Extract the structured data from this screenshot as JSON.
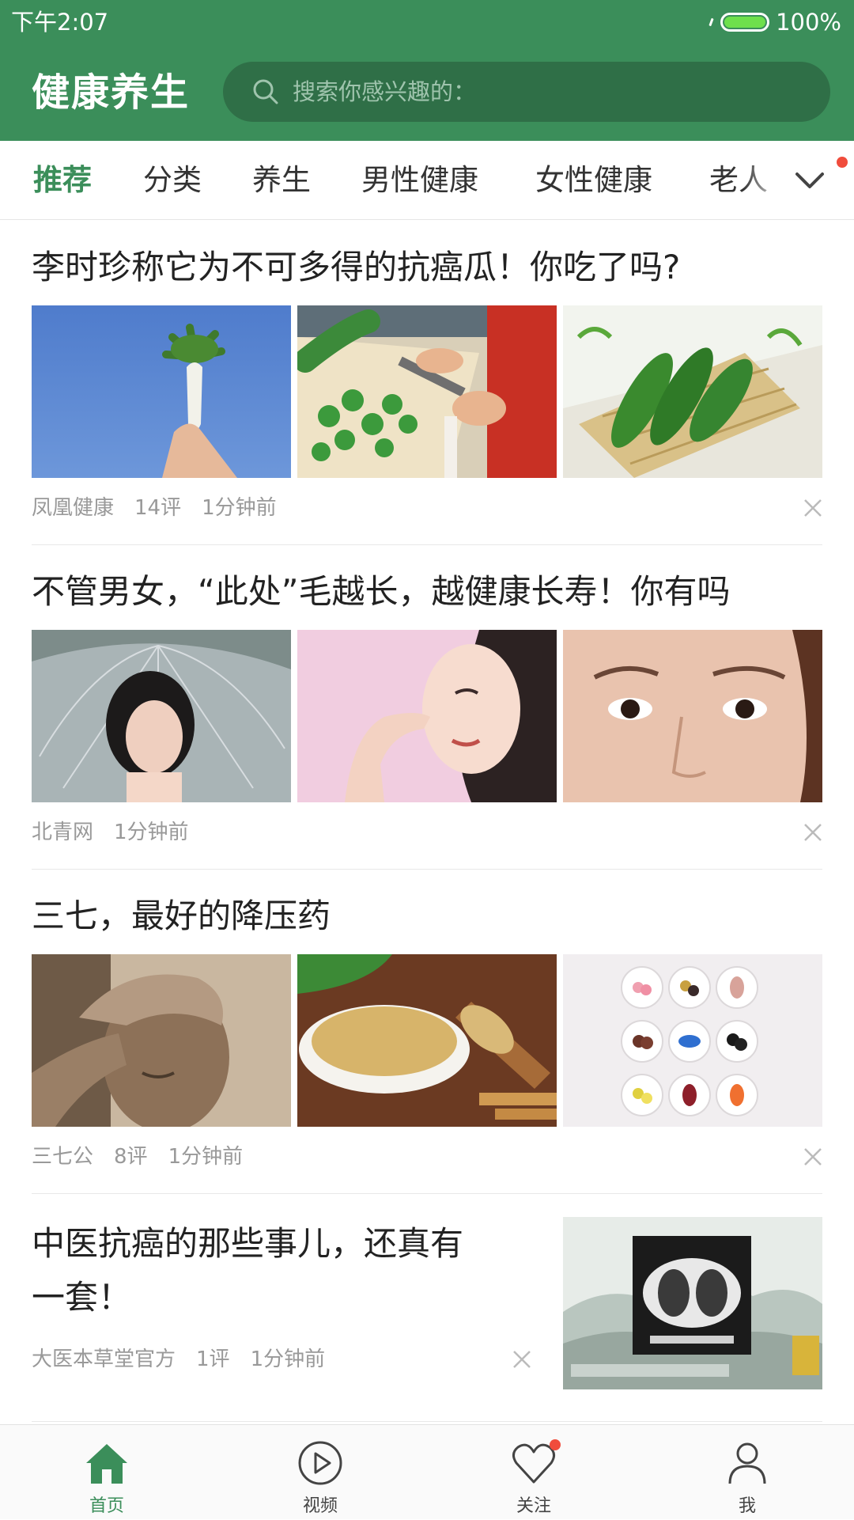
{
  "status_bar": {
    "time": "下午2:07",
    "battery": "100%"
  },
  "header": {
    "title": "健康养生",
    "search_placeholder": "搜索你感兴趣的："
  },
  "tabs": [
    {
      "label": "推荐",
      "active": true
    },
    {
      "label": "分类"
    },
    {
      "label": "养生"
    },
    {
      "label": "男性健康"
    },
    {
      "label": "女性健康"
    },
    {
      "label": "老人"
    }
  ],
  "articles": [
    {
      "title": "李时珍称它为不可多得的抗癌瓜！你吃了吗?",
      "source": "凤凰健康",
      "comments": "14评",
      "time": "1分钟前",
      "images": [
        "radish-in-hand",
        "cutting-bitter-melon",
        "bitter-melons-in-basket"
      ]
    },
    {
      "title": "不管男女，“此处”毛越长，越健康长寿！你有吗",
      "source": "北青网",
      "time": "1分钟前",
      "images": [
        "woman-with-umbrella",
        "woman-touching-nose",
        "woman-eyes-closeup"
      ]
    },
    {
      "title": "三七，最好的降压药",
      "source": "三七公",
      "comments": "8评",
      "time": "1分钟前",
      "images": [
        "man-holding-head",
        "herbal-powder-bowl",
        "pills-in-cups"
      ]
    },
    {
      "title_line1": "中医抗癌的那些事儿，还真有",
      "title_line2": "一套！",
      "source": "大医本草堂官方",
      "comments": "1评",
      "time": "1分钟前",
      "images": [
        "lung-ct-scan-video"
      ]
    }
  ],
  "bottom_nav": [
    {
      "label": "首页",
      "icon": "home-icon",
      "active": true
    },
    {
      "label": "视频",
      "icon": "play-icon"
    },
    {
      "label": "关注",
      "icon": "heart-icon",
      "badge": true
    },
    {
      "label": "我",
      "icon": "person-icon"
    }
  ],
  "colors": {
    "primary": "#3b8e5a",
    "search_bg": "#2f6f47",
    "badge": "#f04c3c",
    "meta_text": "#999999"
  }
}
